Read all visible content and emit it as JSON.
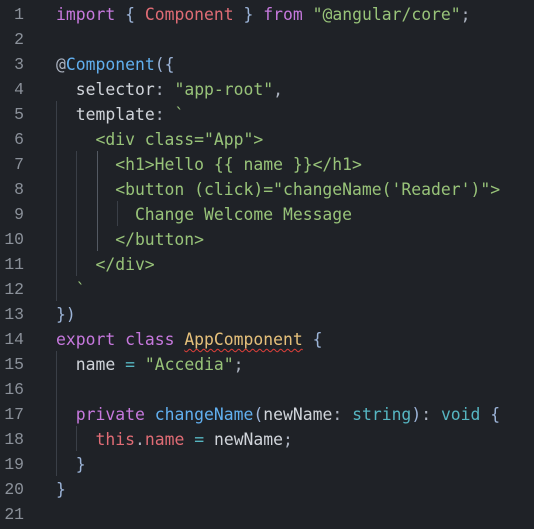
{
  "editor": {
    "language": "typescript",
    "lines": [
      {
        "n": "1",
        "tokens": [
          [
            "kw",
            "import"
          ],
          [
            "punct",
            " "
          ],
          [
            "brace",
            "{"
          ],
          [
            "punct",
            " "
          ],
          [
            "ident",
            "Component"
          ],
          [
            "punct",
            " "
          ],
          [
            "brace",
            "}"
          ],
          [
            "punct",
            " "
          ],
          [
            "kw",
            "from"
          ],
          [
            "punct",
            " "
          ],
          [
            "str",
            "\"@angular/core\""
          ],
          [
            "punct",
            ";"
          ]
        ]
      },
      {
        "n": "2",
        "tokens": []
      },
      {
        "n": "3",
        "tokens": [
          [
            "decor-at",
            "@"
          ],
          [
            "decor",
            "Component"
          ],
          [
            "brace",
            "("
          ],
          [
            "brace",
            "{"
          ]
        ]
      },
      {
        "n": "4",
        "tokens": [
          [
            "punct",
            "  "
          ],
          [
            "plain",
            "selector"
          ],
          [
            "punct",
            ": "
          ],
          [
            "str",
            "\"app-root\""
          ],
          [
            "punct",
            ","
          ]
        ]
      },
      {
        "n": "5",
        "tokens": [
          [
            "punct",
            "  "
          ],
          [
            "plain",
            "template"
          ],
          [
            "punct",
            ": "
          ],
          [
            "str",
            "`"
          ]
        ]
      },
      {
        "n": "6",
        "tokens": [
          [
            "str",
            "    <div class=\"App\">"
          ]
        ]
      },
      {
        "n": "7",
        "tokens": [
          [
            "str",
            "      <h1>Hello {{ name }}</h1>"
          ]
        ]
      },
      {
        "n": "8",
        "tokens": [
          [
            "str",
            "      <button (click)=\"changeName('Reader')\">"
          ]
        ]
      },
      {
        "n": "9",
        "tokens": [
          [
            "str",
            "        Change Welcome Message"
          ]
        ]
      },
      {
        "n": "10",
        "tokens": [
          [
            "str",
            "      </button>"
          ]
        ]
      },
      {
        "n": "11",
        "tokens": [
          [
            "str",
            "    </div>"
          ]
        ]
      },
      {
        "n": "12",
        "tokens": [
          [
            "str",
            "  `"
          ]
        ]
      },
      {
        "n": "13",
        "tokens": [
          [
            "brace",
            "}"
          ],
          [
            "brace",
            ")"
          ]
        ]
      },
      {
        "n": "14",
        "tokens": [
          [
            "kw",
            "export"
          ],
          [
            "punct",
            " "
          ],
          [
            "kw",
            "class"
          ],
          [
            "punct",
            " "
          ],
          [
            "cls",
            "AppComponent"
          ],
          [
            "punct",
            " "
          ],
          [
            "brace",
            "{"
          ]
        ]
      },
      {
        "n": "15",
        "tokens": [
          [
            "punct",
            "  "
          ],
          [
            "plain",
            "name"
          ],
          [
            "punct",
            " "
          ],
          [
            "op",
            "="
          ],
          [
            "punct",
            " "
          ],
          [
            "str",
            "\"Accedia\""
          ],
          [
            "punct",
            ";"
          ]
        ]
      },
      {
        "n": "16",
        "tokens": []
      },
      {
        "n": "17",
        "tokens": [
          [
            "punct",
            "  "
          ],
          [
            "kw",
            "private"
          ],
          [
            "punct",
            " "
          ],
          [
            "fn",
            "changeName"
          ],
          [
            "brace",
            "("
          ],
          [
            "plain",
            "newName"
          ],
          [
            "punct",
            ": "
          ],
          [
            "type",
            "string"
          ],
          [
            "brace",
            ")"
          ],
          [
            "punct",
            ": "
          ],
          [
            "type",
            "void"
          ],
          [
            "punct",
            " "
          ],
          [
            "brace",
            "{"
          ]
        ]
      },
      {
        "n": "18",
        "tokens": [
          [
            "punct",
            "    "
          ],
          [
            "this",
            "this"
          ],
          [
            "punct",
            "."
          ],
          [
            "this",
            "name"
          ],
          [
            "punct",
            " "
          ],
          [
            "op",
            "="
          ],
          [
            "punct",
            " "
          ],
          [
            "plain",
            "newName"
          ],
          [
            "punct",
            ";"
          ]
        ]
      },
      {
        "n": "19",
        "tokens": [
          [
            "punct",
            "  "
          ],
          [
            "brace",
            "}"
          ]
        ]
      },
      {
        "n": "20",
        "tokens": [
          [
            "brace",
            "}"
          ]
        ]
      },
      {
        "n": "21",
        "tokens": []
      }
    ],
    "diagnostics": [
      {
        "line": "14",
        "symbol": "AppComponent",
        "severity": "error"
      }
    ]
  }
}
